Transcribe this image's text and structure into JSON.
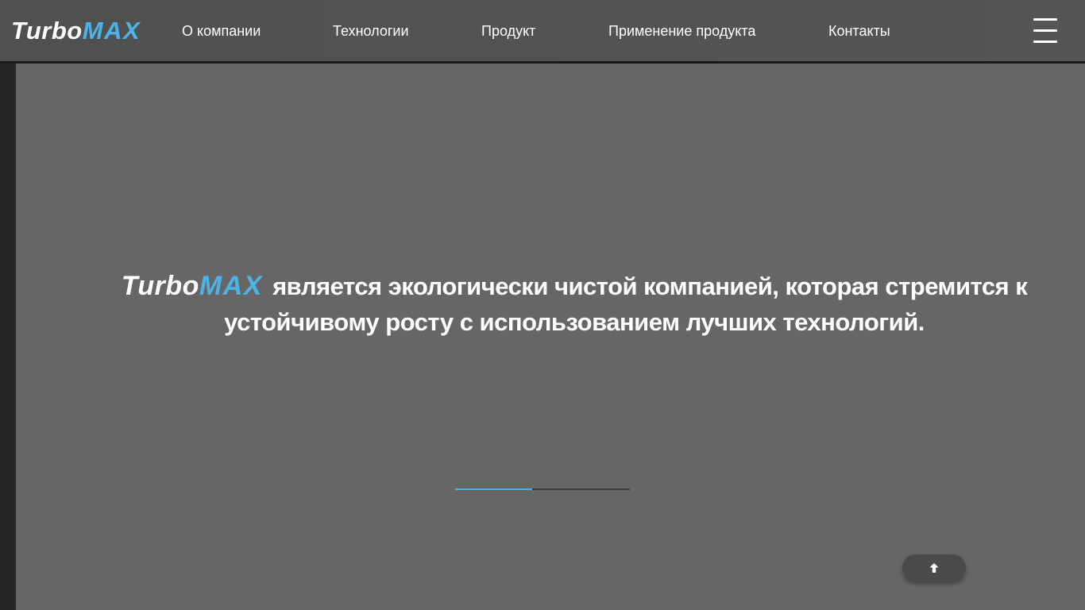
{
  "brand": {
    "part1": "Turbo",
    "part2": "MAX",
    "accent_color": "#4db3e6"
  },
  "nav": {
    "items": [
      {
        "label": "О компании"
      },
      {
        "label": "Технологии"
      },
      {
        "label": "Продукт"
      },
      {
        "label": "Применение продукта"
      },
      {
        "label": "Контакты"
      }
    ],
    "menu_icon": "hamburger-menu-icon"
  },
  "hero": {
    "logo_part1": "Turbo",
    "logo_part2": "MAX",
    "text": "является экологически чистой компанией, которая стремится к устойчивому росту с использованием лучших технологий."
  },
  "slider": {
    "progress_fraction": 0.44
  },
  "scroll_top": {
    "icon": "arrow-up-icon"
  }
}
